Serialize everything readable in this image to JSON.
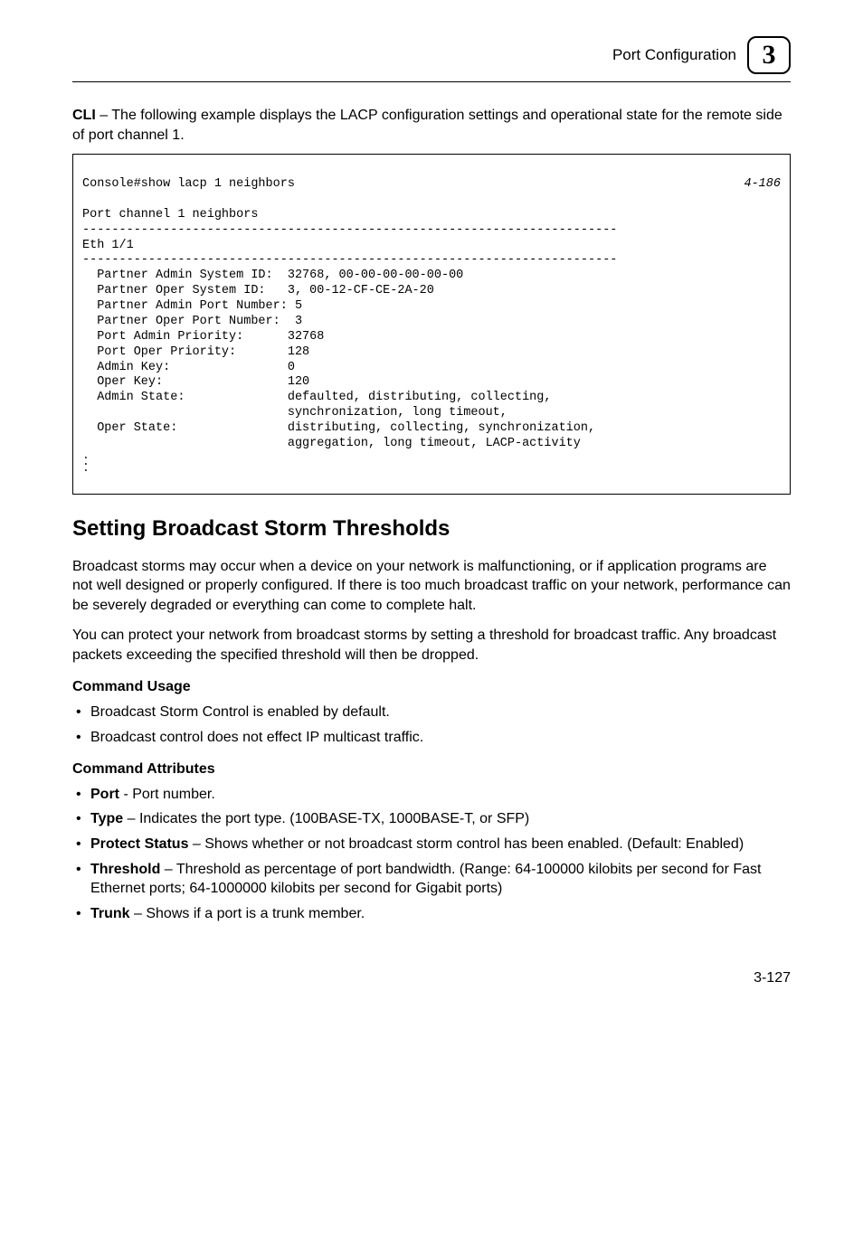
{
  "header": {
    "label": "Port Configuration",
    "chapter_number": "3"
  },
  "intro_para_prefix_bold": "CLI",
  "intro_para_text": " – The following example displays the LACP configuration settings and operational state for the remote side of port channel 1.",
  "cli": {
    "cmd": "Console#show lacp 1 neighbors",
    "ref": "4-186",
    "line2": "Port channel 1 neighbors",
    "dash1": "-------------------------------------------------------------------------",
    "eth": "Eth 1/1",
    "dash2": "-------------------------------------------------------------------------",
    "r1": "  Partner Admin System ID:  32768, 00-00-00-00-00-00",
    "r2": "  Partner Oper System ID:   3, 00-12-CF-CE-2A-20",
    "r3": "  Partner Admin Port Number: 5",
    "r4": "  Partner Oper Port Number:  3",
    "r5": "  Port Admin Priority:      32768",
    "r6": "  Port Oper Priority:       128",
    "r7": "  Admin Key:                0",
    "r8": "  Oper Key:                 120",
    "r9": "  Admin State:              defaulted, distributing, collecting,",
    "r9b": "                            synchronization, long timeout,",
    "r10": "  Oper State:               distributing, collecting, synchronization,",
    "r10b": "                            aggregation, long timeout, LACP-activity"
  },
  "section_title": "Setting Broadcast Storm Thresholds",
  "para1": "Broadcast storms may occur when a device on your network is malfunctioning, or if application programs are not well designed or properly configured. If there is too much broadcast traffic on your network, performance can be severely degraded or everything can come to complete halt.",
  "para2": "You can protect your network from broadcast storms by setting a threshold for broadcast traffic. Any broadcast packets exceeding the specified threshold will then be dropped.",
  "cmd_usage_heading": "Command Usage",
  "usage_bullets": {
    "b1": "Broadcast Storm Control is enabled by default.",
    "b2": "Broadcast control does not effect IP multicast traffic."
  },
  "cmd_attr_heading": "Command Attributes",
  "attr_bullets": {
    "b1_bold": "Port",
    "b1_rest": " - Port number.",
    "b2_bold": "Type",
    "b2_rest": " – Indicates the port type. (100BASE-TX, 1000BASE-T, or SFP)",
    "b3_bold": "Protect Status",
    "b3_rest": " – Shows whether or not broadcast storm control has been enabled. (Default: Enabled)",
    "b4_bold": "Threshold",
    "b4_rest": " – Threshold as percentage of port bandwidth. (Range: 64-100000 kilobits per second for Fast Ethernet ports; 64-1000000 kilobits per second for Gigabit ports)",
    "b5_bold": "Trunk",
    "b5_rest": " – Shows if a port is a trunk member."
  },
  "page_number": "3-127"
}
